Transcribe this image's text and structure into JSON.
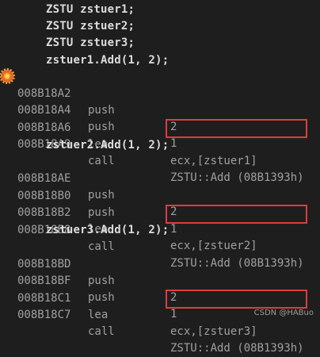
{
  "source_lines": [
    "ZSTU zstuer1;",
    "ZSTU zstuer2;",
    "ZSTU zstuer3;",
    "zstuer1.Add(1, 2);",
    "zstuer2.Add(1, 2);",
    "zstuer3.Add(1, 2);"
  ],
  "disasm": [
    {
      "addr": "008B18A2",
      "mn": "push",
      "op": "2"
    },
    {
      "addr": "008B18A4",
      "mn": "push",
      "op": "1"
    },
    {
      "addr": "008B18A6",
      "mn": "lea",
      "op": "ecx,[zstuer1]"
    },
    {
      "addr": "008B18A9",
      "mn": "call",
      "op": "ZSTU::Add (08B1393h)"
    },
    {
      "addr": "008B18AE",
      "mn": "push",
      "op": "2"
    },
    {
      "addr": "008B18B0",
      "mn": "push",
      "op": "1"
    },
    {
      "addr": "008B18B2",
      "mn": "lea",
      "op": "ecx,[zstuer2]"
    },
    {
      "addr": "008B18B8",
      "mn": "call",
      "op": "ZSTU::Add (08B1393h)"
    },
    {
      "addr": "008B18BD",
      "mn": "push",
      "op": "2"
    },
    {
      "addr": "008B18BF",
      "mn": "push",
      "op": "1"
    },
    {
      "addr": "008B18C1",
      "mn": "lea",
      "op": "ecx,[zstuer3]"
    },
    {
      "addr": "008B18C7",
      "mn": "call",
      "op": "ZSTU::Add (08B1393h)"
    }
  ],
  "watermark": "CSDN @HABuo",
  "colors": {
    "background": "#1e1e1e",
    "highlight_border": "#e03c3c"
  }
}
